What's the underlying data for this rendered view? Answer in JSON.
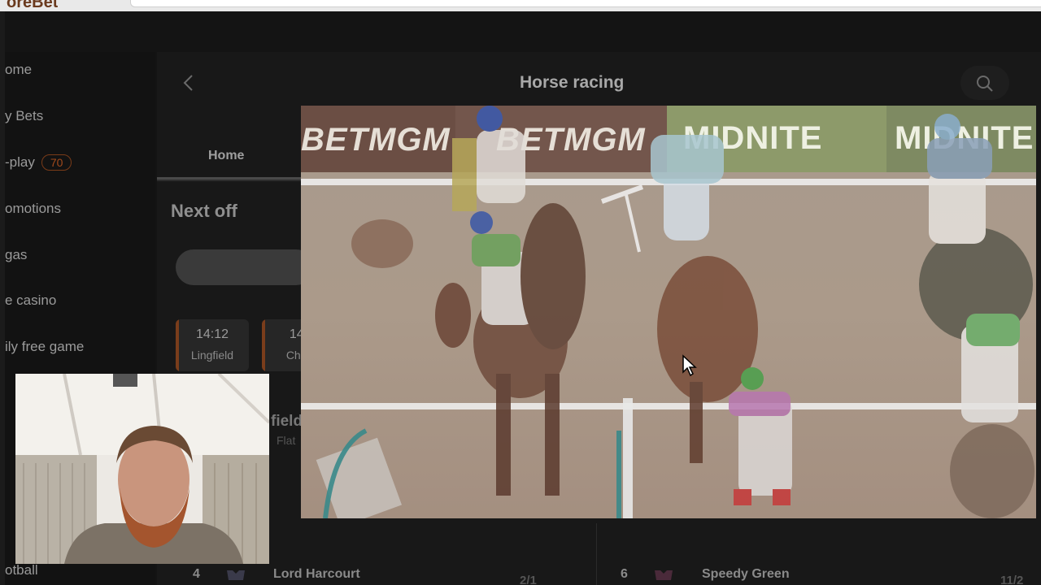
{
  "brand": {
    "logo_fragment": "oreBet"
  },
  "sidebar": {
    "items": [
      {
        "label": "ome"
      },
      {
        "label": "y Bets"
      },
      {
        "label": "-play",
        "badge": "70"
      },
      {
        "label": "omotions"
      },
      {
        "label": "gas"
      },
      {
        "label": "e casino"
      },
      {
        "label": "ily free game"
      },
      {
        "label": "otball"
      }
    ]
  },
  "header": {
    "title": "Horse racing"
  },
  "tabs": [
    {
      "label": "Home"
    }
  ],
  "section": {
    "title": "Next off"
  },
  "races": [
    {
      "time": "14:12",
      "track": "Lingfield"
    },
    {
      "time": "14:",
      "track": "Char"
    }
  ],
  "race_fragment": {
    "title": "field",
    "subtitle": "Flat"
  },
  "runners": [
    {
      "number": "4",
      "name": "Lord Harcourt",
      "odds": "2/1"
    },
    {
      "number": "6",
      "name": "Speedy Green",
      "odds": "11/2"
    }
  ],
  "video": {
    "banners": [
      "BETMGM",
      "BETMGM",
      "MIDNITE",
      "MIDNITE"
    ],
    "track_color": "#a89a8b"
  },
  "colors": {
    "accent": "#a14a1c",
    "background": "#141414"
  }
}
